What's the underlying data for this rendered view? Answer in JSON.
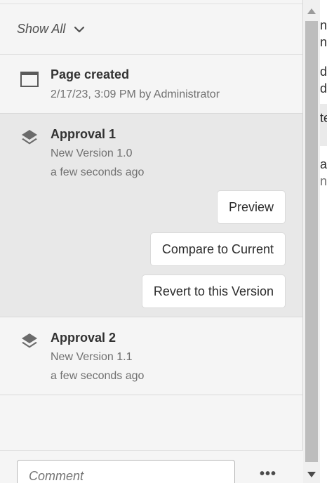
{
  "filter": {
    "label": "Show All"
  },
  "timeline": [
    {
      "title": "Page created",
      "subtitle": "2/17/23, 3:09 PM by Administrator"
    },
    {
      "title": "Approval 1",
      "version": "New Version 1.0",
      "time": "a few seconds ago",
      "actions": {
        "preview": "Preview",
        "compare": "Compare to Current",
        "revert": "Revert to this Version"
      }
    },
    {
      "title": "Approval 2",
      "version": "New Version 1.1",
      "time": "a few seconds ago"
    }
  ],
  "comment": {
    "placeholder": "Comment",
    "more": "•••"
  },
  "edge_text": [
    "n",
    "n",
    "d",
    "d",
    "te",
    "ar",
    "n"
  ],
  "colors": {
    "panel_bg": "#f5f5f5",
    "selected_bg": "#e8e8e8",
    "button_bg": "#ffffff",
    "scroll_thumb": "#bdbdbd"
  },
  "icons": {
    "filter_chevron": "chevron-down-icon",
    "page": "page-icon",
    "version": "layers-icon"
  }
}
